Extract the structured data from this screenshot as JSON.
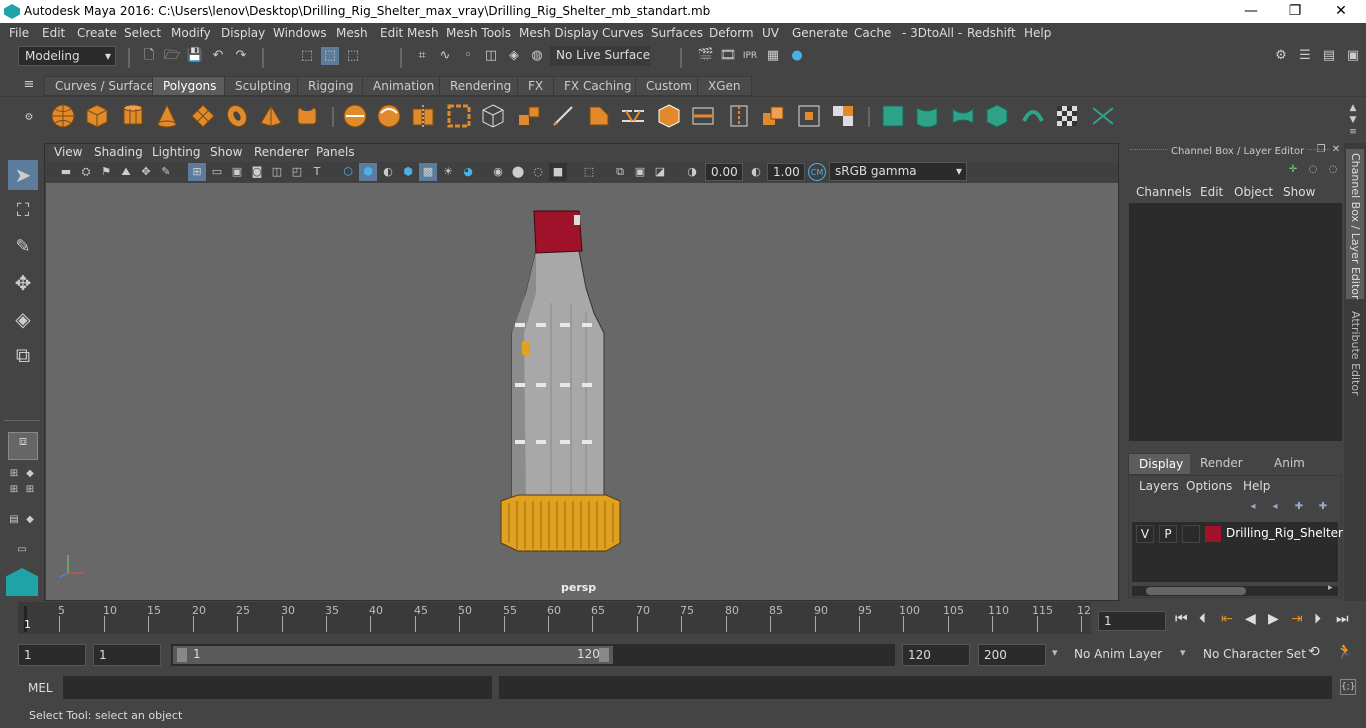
{
  "window": {
    "title": "Autodesk Maya 2016: C:\\Users\\lenov\\Desktop\\Drilling_Rig_Shelter_max_vray\\Drilling_Rig_Shelter_mb_standart.mb"
  },
  "menus": [
    "File",
    "Edit",
    "Create",
    "Select",
    "Modify",
    "Display",
    "Windows",
    "Mesh",
    "Edit Mesh",
    "Mesh Tools",
    "Mesh Display",
    "Curves",
    "Surfaces",
    "Deform",
    "UV",
    "Generate",
    "Cache",
    "- 3DtoAll -",
    "Redshift",
    "Help"
  ],
  "status": {
    "mode": "Modeling",
    "live_surface": "No Live Surface"
  },
  "shelf_tabs": [
    "Curves / Surfaces",
    "Polygons",
    "Sculpting",
    "Rigging",
    "Animation",
    "Rendering",
    "FX",
    "FX Caching",
    "Custom",
    "XGen"
  ],
  "shelf_active": "Polygons",
  "viewport": {
    "menus": [
      "View",
      "Shading",
      "Lighting",
      "Show",
      "Renderer",
      "Panels"
    ],
    "exposure": "0.00",
    "gamma": "1.00",
    "colorspace": "sRGB gamma",
    "camera_label": "persp"
  },
  "channel_box": {
    "title": "Channel Box / Layer Editor",
    "menus": [
      "Channels",
      "Edit",
      "Object",
      "Show"
    ]
  },
  "layer_editor": {
    "tabs": [
      "Display",
      "Render",
      "Anim"
    ],
    "active_tab": "Display",
    "menus": [
      "Layers",
      "Options",
      "Help"
    ],
    "layers": [
      {
        "v": "V",
        "p": "P",
        "name": "Drilling_Rig_Shelter",
        "color": "#a0122a"
      }
    ]
  },
  "side_tabs": [
    "Channel Box / Layer Editor",
    "Attribute Editor"
  ],
  "timeline": {
    "labels": [
      "5",
      "10",
      "15",
      "20",
      "25",
      "30",
      "35",
      "40",
      "45",
      "50",
      "55",
      "60",
      "65",
      "70",
      "75",
      "80",
      "85",
      "90",
      "95",
      "100",
      "105",
      "110",
      "115",
      "12"
    ],
    "first_label": "1",
    "current_frame": "1"
  },
  "range": {
    "start": "1",
    "playback_start": "1",
    "slider_start": "1",
    "slider_end": "120",
    "playback_end": "120",
    "end": "200",
    "anim_layer": "No Anim Layer",
    "character_set": "No Character Set"
  },
  "mel": {
    "label": "MEL"
  },
  "help_line": "Select Tool: select an object",
  "colors": {
    "orange_icon": "#e08a2c",
    "teal_icon": "#2fa38a",
    "shelter_red": "#a0122a",
    "base_yellow": "#e0a020"
  }
}
